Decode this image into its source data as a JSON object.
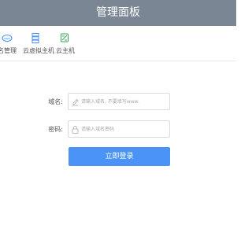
{
  "header": {
    "title": "管理面板"
  },
  "tabs": [
    {
      "label": "名管理",
      "icon": "domain-badge-icon"
    },
    {
      "label": "云虚拟主机",
      "icon": "server-icon"
    },
    {
      "label": "云主机",
      "icon": "cloud-host-icon"
    }
  ],
  "form": {
    "domain_label": "域名:",
    "domain_placeholder": "请输入域名, 不要填写www.",
    "password_label": "密码:",
    "password_placeholder": "请输入域名密码"
  },
  "login_button": "立即登录",
  "colors": {
    "header_bg": "#7a8693",
    "accent": "#4b93f6",
    "icon_green": "#3aa55a"
  }
}
